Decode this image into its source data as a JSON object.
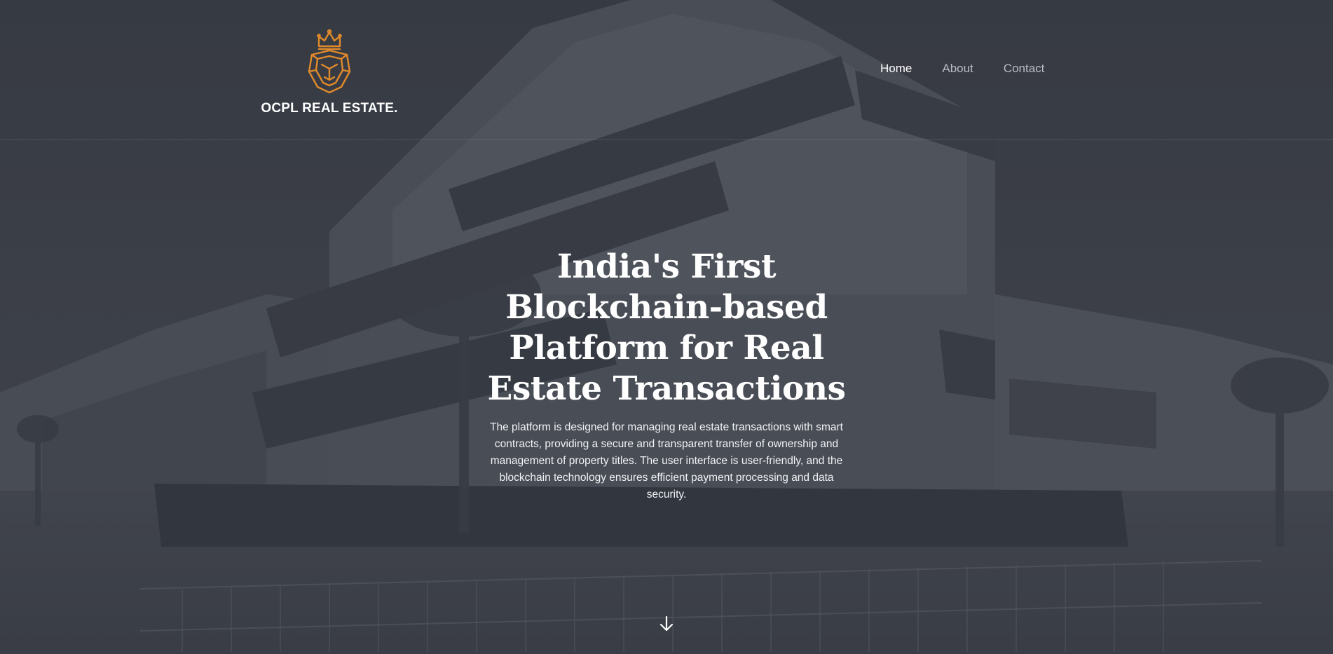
{
  "brand": {
    "name": "OCPL REAL ESTATE.",
    "logo_icon": "crowned-lion-icon",
    "accent_color": "#e08a2a"
  },
  "nav": {
    "items": [
      {
        "label": "Home",
        "active": true
      },
      {
        "label": "About",
        "active": false
      },
      {
        "label": "Contact",
        "active": false
      }
    ]
  },
  "hero": {
    "title": "India's First Blockchain-based Platform for Real Estate Transactions",
    "description": "The platform is designed for managing real estate transactions with smart contracts, providing a secure and transparent transfer of ownership and management of property titles. The user interface is user-friendly, and the blockchain technology ensures efficient payment processing and data security.",
    "scroll_icon": "arrow-down-icon",
    "overlay_color": "#3a3e47"
  }
}
